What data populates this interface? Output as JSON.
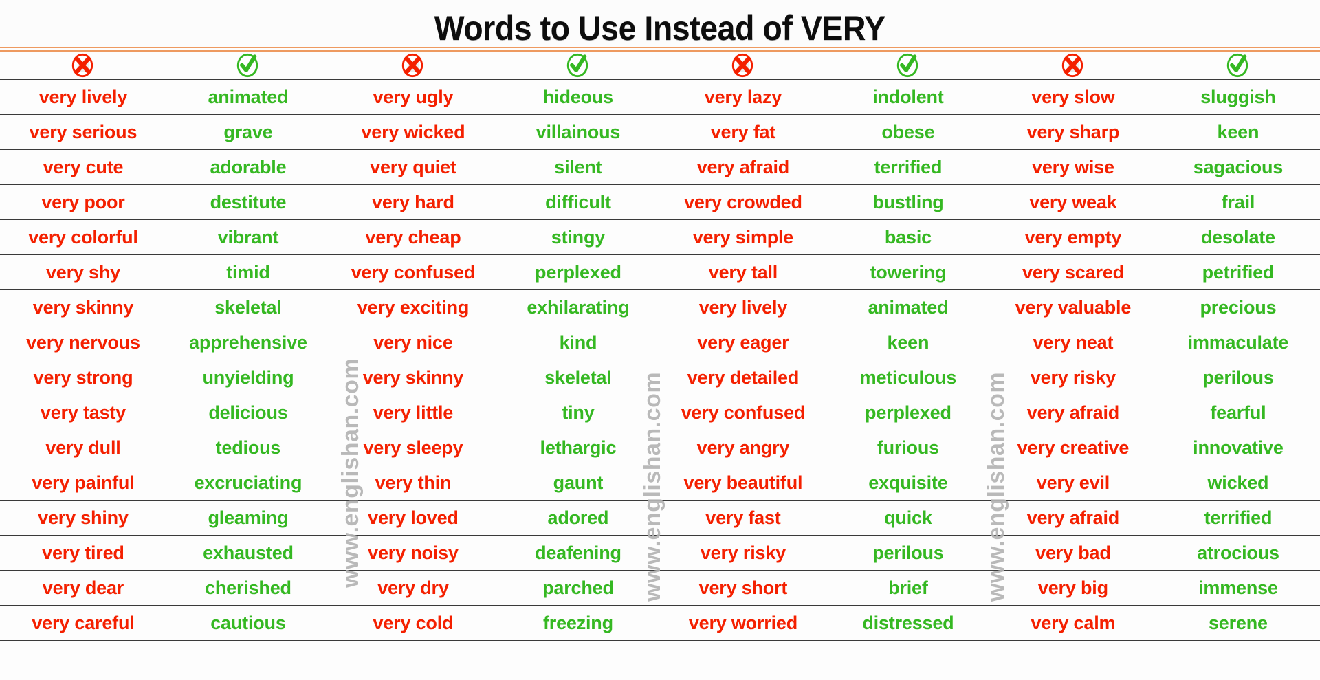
{
  "header": {
    "title": "Words to Use Instead of VERY",
    "accent_orange": "#ee9a60",
    "bad_color": "#f42000",
    "good_color": "#35b822"
  },
  "column_icons": [
    {
      "name": "cross-icon",
      "glyph": "✖",
      "type": "bad"
    },
    {
      "name": "check-icon",
      "glyph": "✔",
      "type": "good"
    },
    {
      "name": "cross-icon",
      "glyph": "✖",
      "type": "bad"
    },
    {
      "name": "check-icon",
      "glyph": "✔",
      "type": "good"
    },
    {
      "name": "cross-icon",
      "glyph": "✖",
      "type": "bad"
    },
    {
      "name": "check-icon",
      "glyph": "✔",
      "type": "good"
    },
    {
      "name": "cross-icon",
      "glyph": "✖",
      "type": "bad"
    },
    {
      "name": "check-icon",
      "glyph": "✔",
      "type": "good"
    }
  ],
  "watermarks": [
    "www.englishan.com",
    "www.englishan.com",
    "www.englishan.com"
  ],
  "rows": [
    [
      "very lively",
      "animated",
      "very ugly",
      "hideous",
      "very lazy",
      "indolent",
      "very slow",
      "sluggish"
    ],
    [
      "very serious",
      "grave",
      "very wicked",
      "villainous",
      "very fat",
      "obese",
      "very sharp",
      "keen"
    ],
    [
      "very cute",
      "adorable",
      "very quiet",
      "silent",
      "very afraid",
      "terrified",
      "very wise",
      "sagacious"
    ],
    [
      "very poor",
      "destitute",
      "very hard",
      "difficult",
      "very crowded",
      "bustling",
      "very weak",
      "frail"
    ],
    [
      "very colorful",
      "vibrant",
      "very cheap",
      "stingy",
      "very simple",
      "basic",
      "very empty",
      "desolate"
    ],
    [
      "very shy",
      "timid",
      "very confused",
      "perplexed",
      "very tall",
      "towering",
      "very scared",
      "petrified"
    ],
    [
      "very skinny",
      "skeletal",
      "very exciting",
      "exhilarating",
      "very lively",
      "animated",
      "very valuable",
      "precious"
    ],
    [
      "very nervous",
      "apprehensive",
      "very nice",
      "kind",
      "very eager",
      "keen",
      "very neat",
      "immaculate"
    ],
    [
      "very strong",
      "unyielding",
      "very skinny",
      "skeletal",
      "very detailed",
      "meticulous",
      "very risky",
      "perilous"
    ],
    [
      "very tasty",
      "delicious",
      "very little",
      "tiny",
      "very confused",
      "perplexed",
      "very afraid",
      "fearful"
    ],
    [
      "very dull",
      "tedious",
      "very sleepy",
      "lethargic",
      "very angry",
      "furious",
      "very creative",
      "innovative"
    ],
    [
      "very painful",
      "excruciating",
      "very thin",
      "gaunt",
      "very beautiful",
      "exquisite",
      "very evil",
      "wicked"
    ],
    [
      "very shiny",
      "gleaming",
      "very loved",
      "adored",
      "very fast",
      "quick",
      "very afraid",
      "terrified"
    ],
    [
      "very tired",
      "exhausted",
      "very noisy",
      "deafening",
      "very risky",
      "perilous",
      "very bad",
      "atrocious"
    ],
    [
      "very dear",
      "cherished",
      "very dry",
      "parched",
      "very short",
      "brief",
      "very big",
      "immense"
    ],
    [
      "very careful",
      "cautious",
      "very cold",
      "freezing",
      "very worried",
      "distressed",
      "very calm",
      "serene"
    ]
  ]
}
